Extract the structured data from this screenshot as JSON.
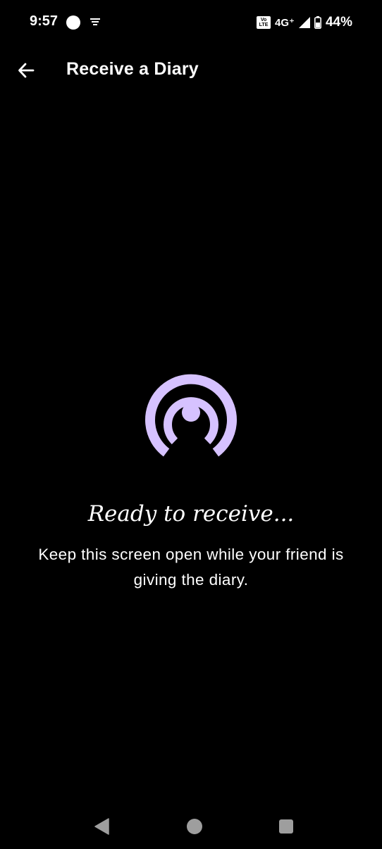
{
  "status_bar": {
    "time": "9:57",
    "volte": "Vo LTE",
    "network": "4G⁺",
    "battery": "44%"
  },
  "app_bar": {
    "title": "Receive a Diary",
    "back_icon": "arrow-left-icon"
  },
  "main": {
    "icon": "broadcast-receive-icon",
    "heading": "Ready to receive...",
    "instructions": "Keep this screen open while your friend is giving the diary."
  },
  "colors": {
    "background": "#000000",
    "accent": "#D6C2FF",
    "text": "#FFFFFF",
    "nav": "#9E9E9E"
  },
  "nav_bar": {
    "back_icon": "triangle-back-icon",
    "home_icon": "circle-home-icon",
    "recents_icon": "square-recents-icon"
  }
}
